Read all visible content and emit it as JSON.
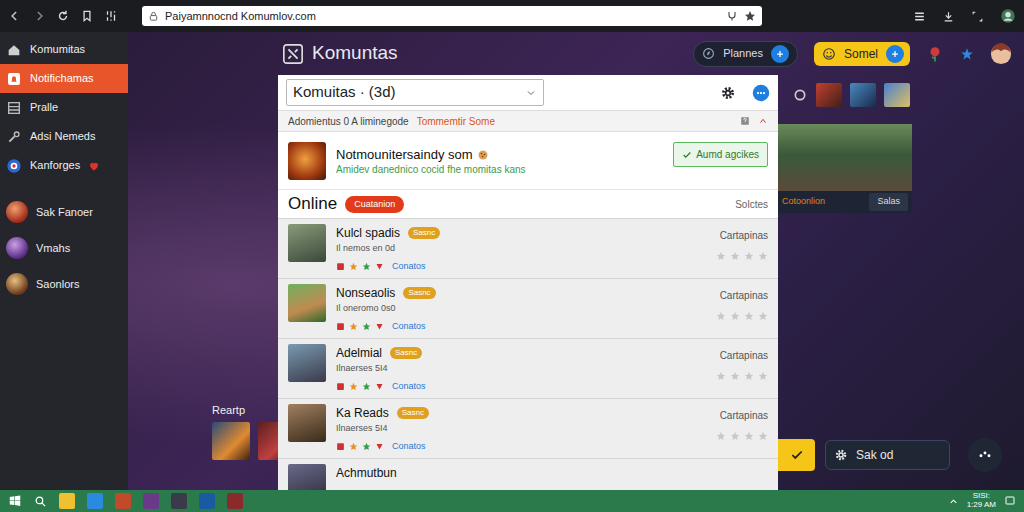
{
  "browser": {
    "url": "Paiyamnnocnd Komumlov.com"
  },
  "sidebar": {
    "items": [
      {
        "label": "Komumitas",
        "kind": "nav",
        "selected": false,
        "favorite": false
      },
      {
        "label": "Notifichamas",
        "kind": "nav",
        "selected": true,
        "favorite": false
      },
      {
        "label": "Pralle",
        "kind": "nav",
        "selected": false,
        "favorite": false
      },
      {
        "label": "Adsi Nemeds",
        "kind": "nav",
        "selected": false,
        "favorite": false
      },
      {
        "label": "Kanforges",
        "kind": "nav",
        "selected": false,
        "favorite": true
      },
      {
        "label": "Sak Fanoer",
        "kind": "friend",
        "selected": false,
        "favorite": false
      },
      {
        "label": "Vmahs",
        "kind": "friend",
        "selected": false,
        "favorite": false
      },
      {
        "label": "Saonlors",
        "kind": "friend",
        "selected": false,
        "favorite": false
      }
    ]
  },
  "header": {
    "title": "Komuntas",
    "planner": "Plannes",
    "action": "Somel"
  },
  "left": {
    "label": "Reartp"
  },
  "panel": {
    "dropdown": "Komuitas · (3d)",
    "info": {
      "text": "Adomientus 0 A liminegode",
      "highlight": "Tommemtir Some"
    },
    "featured": {
      "title": "Notmounitersaindy som",
      "text": "Amidev danednico cocid fhe momitas kans",
      "button": "Aumd agcikes"
    },
    "online": {
      "title": "Online",
      "tag": "Cuatanion",
      "sort": "Solctes"
    },
    "rows": [
      {
        "name": "Kulcl spadis",
        "badge": "Sasnc",
        "sub": "Il nemos en 0d",
        "link": "Conatos",
        "category": "Cartapinas",
        "stars": 0
      },
      {
        "name": "Nonseaolis",
        "badge": "Sasnc",
        "sub": "Il oneromo 0s0",
        "link": "Conatos",
        "category": "Cartapinas",
        "stars": 0
      },
      {
        "name": "Adelmial",
        "badge": "Sasnc",
        "sub": "Ilnaerses 5I4",
        "link": "Conatos",
        "category": "Cartapinas",
        "stars": 0
      },
      {
        "name": "Ka Reads",
        "badge": "Sasnc",
        "sub": "Ilnaerses 5I4",
        "link": "Conatos",
        "category": "Cartapinas",
        "stars": 0
      },
      {
        "name": "Achmutbun"
      }
    ]
  },
  "right": {
    "caption": "Cotoonlion",
    "button": "Salas",
    "pill": "Sak od"
  },
  "taskbar": {
    "tray": [
      "SISI:",
      "1:29 AM"
    ]
  }
}
